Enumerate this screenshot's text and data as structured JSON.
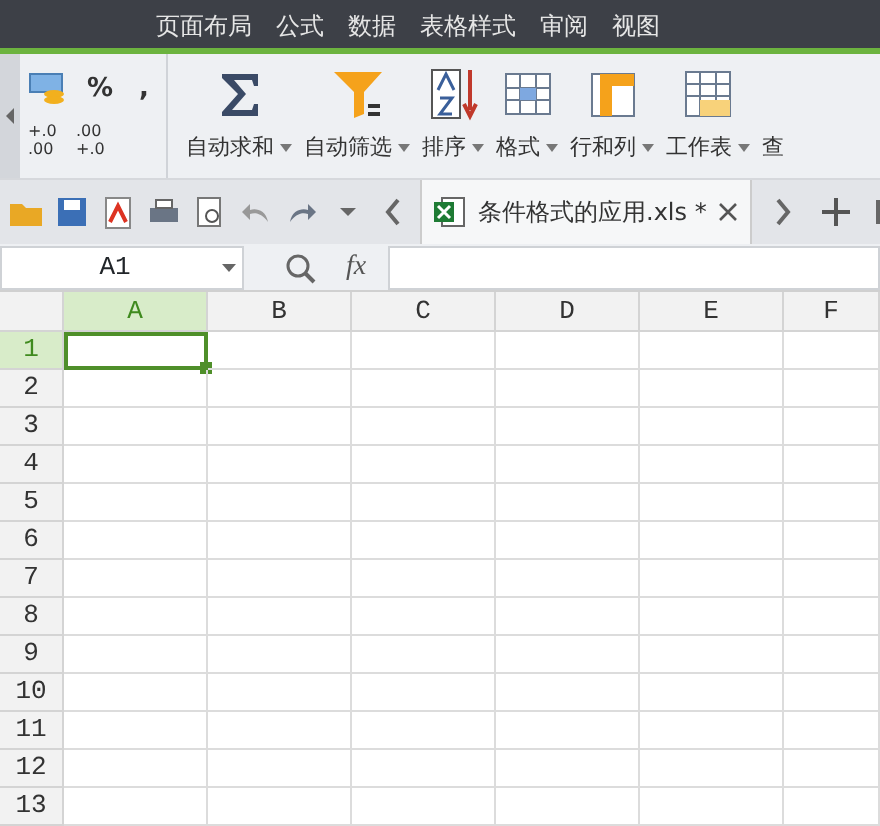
{
  "menu_tabs": [
    {
      "label": "页面布局"
    },
    {
      "label": "公式"
    },
    {
      "label": "数据"
    },
    {
      "label": "表格样式"
    },
    {
      "label": "审阅"
    },
    {
      "label": "视图"
    }
  ],
  "ribbon": {
    "format_buttons": [
      {
        "kind": "currency"
      },
      {
        "kind": "text",
        "label": "%"
      },
      {
        "kind": "text",
        "label": ","
      },
      {
        "kind": "decimal",
        "lines": [
          "+.0",
          ".00"
        ]
      },
      {
        "kind": "decimal",
        "lines": [
          ".00",
          "+.0"
        ]
      }
    ],
    "big_buttons": [
      {
        "kind": "sum",
        "label": "自动求和",
        "dropdown": true
      },
      {
        "kind": "filter",
        "label": "自动筛选",
        "dropdown": true
      },
      {
        "kind": "sort",
        "label": "排序",
        "dropdown": true
      },
      {
        "kind": "format",
        "label": "格式",
        "dropdown": true
      },
      {
        "kind": "rowcol",
        "label": "行和列",
        "dropdown": true
      },
      {
        "kind": "sheet",
        "label": "工作表",
        "dropdown": true
      },
      {
        "kind": "plain",
        "label": "查",
        "dropdown": false
      }
    ]
  },
  "document_tabs": [
    {
      "title": "条件格式的应用.xls *",
      "selected": true
    }
  ],
  "name_box": "A1",
  "formula_label": "fx",
  "columns": [
    {
      "label": "A",
      "selected": true
    },
    {
      "label": "B",
      "selected": false
    },
    {
      "label": "C",
      "selected": false
    },
    {
      "label": "D",
      "selected": false
    },
    {
      "label": "E",
      "selected": false
    },
    {
      "label": "F",
      "selected": false
    }
  ],
  "rows": [
    {
      "label": "1",
      "selected": true
    },
    {
      "label": "2",
      "selected": false
    },
    {
      "label": "3",
      "selected": false
    },
    {
      "label": "4",
      "selected": false
    },
    {
      "label": "5",
      "selected": false
    },
    {
      "label": "6",
      "selected": false
    },
    {
      "label": "7",
      "selected": false
    },
    {
      "label": "8",
      "selected": false
    },
    {
      "label": "9",
      "selected": false
    },
    {
      "label": "10",
      "selected": false
    },
    {
      "label": "11",
      "selected": false
    },
    {
      "label": "12",
      "selected": false
    },
    {
      "label": "13",
      "selected": false
    }
  ]
}
